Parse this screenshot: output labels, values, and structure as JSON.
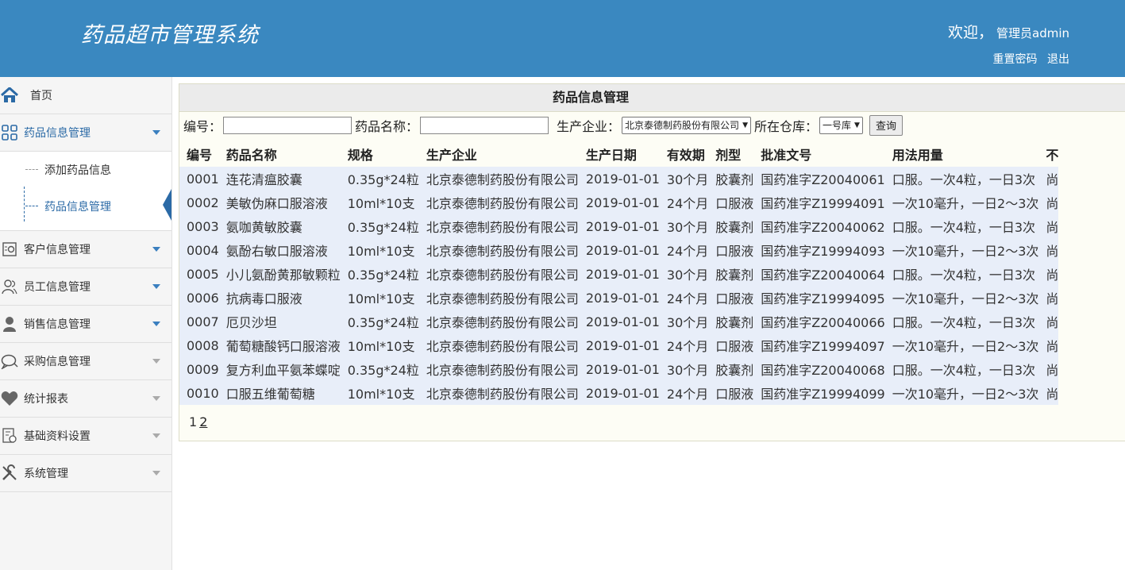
{
  "header": {
    "title": "药品超市管理系统",
    "welcome": "欢迎，",
    "username": "管理员admin",
    "reset_password": "重置密码",
    "logout": "退出"
  },
  "sidebar": {
    "home": "首页",
    "drug_mgmt": "药品信息管理",
    "add_drug": "添加药品信息",
    "drug_info_mgmt": "药品信息管理",
    "customer": "客户信息管理",
    "employee": "员工信息管理",
    "sales": "销售信息管理",
    "purchase": "采购信息管理",
    "reports": "统计报表",
    "basic": "基础资料设置",
    "system": "系统管理"
  },
  "panel": {
    "title": "药品信息管理"
  },
  "filter": {
    "code_label": "编号：",
    "name_label": "药品名称：",
    "maker_label": "生产企业：",
    "maker_value": "北京泰德制药股份有限公司",
    "warehouse_label": "所在仓库：",
    "warehouse_value": "一号库",
    "query_button": "查询"
  },
  "table": {
    "headers": [
      "编号",
      "药品名称",
      "规格",
      "生产企业",
      "生产日期",
      "有效期",
      "剂型",
      "批准文号",
      "用法用量",
      "不"
    ],
    "rows": [
      [
        "0001",
        "连花清瘟胶囊",
        "0.35g*24粒",
        "北京泰德制药股份有限公司",
        "2019-01-01",
        "30个月",
        "胶囊剂",
        "国药准字Z20040061",
        "口服。一次4粒，一日3次",
        "尚"
      ],
      [
        "0002",
        "美敏伪麻口服溶液",
        "10ml*10支",
        "北京泰德制药股份有限公司",
        "2019-01-01",
        "24个月",
        "口服液",
        "国药准字Z19994091",
        "一次10毫升，一日2～3次",
        "尚"
      ],
      [
        "0003",
        "氨咖黄敏胶囊",
        "0.35g*24粒",
        "北京泰德制药股份有限公司",
        "2019-01-01",
        "30个月",
        "胶囊剂",
        "国药准字Z20040062",
        "口服。一次4粒，一日3次",
        "尚"
      ],
      [
        "0004",
        "氨酚右敏口服溶液",
        "10ml*10支",
        "北京泰德制药股份有限公司",
        "2019-01-01",
        "24个月",
        "口服液",
        "国药准字Z19994093",
        "一次10毫升，一日2～3次",
        "尚"
      ],
      [
        "0005",
        "小儿氨酚黄那敏颗粒",
        "0.35g*24粒",
        "北京泰德制药股份有限公司",
        "2019-01-01",
        "30个月",
        "胶囊剂",
        "国药准字Z20040064",
        "口服。一次4粒，一日3次",
        "尚"
      ],
      [
        "0006",
        "抗病毒口服液",
        "10ml*10支",
        "北京泰德制药股份有限公司",
        "2019-01-01",
        "24个月",
        "口服液",
        "国药准字Z19994095",
        "一次10毫升，一日2～3次",
        "尚"
      ],
      [
        "0007",
        "厄贝沙坦",
        "0.35g*24粒",
        "北京泰德制药股份有限公司",
        "2019-01-01",
        "30个月",
        "胶囊剂",
        "国药准字Z20040066",
        "口服。一次4粒，一日3次",
        "尚"
      ],
      [
        "0008",
        "葡萄糖酸钙口服溶液",
        "10ml*10支",
        "北京泰德制药股份有限公司",
        "2019-01-01",
        "24个月",
        "口服液",
        "国药准字Z19994097",
        "一次10毫升，一日2～3次",
        "尚"
      ],
      [
        "0009",
        "复方利血平氨苯蝶啶",
        "0.35g*24粒",
        "北京泰德制药股份有限公司",
        "2019-01-01",
        "30个月",
        "胶囊剂",
        "国药准字Z20040068",
        "口服。一次4粒，一日3次",
        "尚"
      ],
      [
        "0010",
        "口服五维葡萄糖",
        "10ml*10支",
        "北京泰德制药股份有限公司",
        "2019-01-01",
        "24个月",
        "口服液",
        "国药准字Z19994099",
        "一次10毫升，一日2～3次",
        "尚"
      ]
    ]
  },
  "pager": {
    "page1": "1",
    "page2": "2"
  }
}
